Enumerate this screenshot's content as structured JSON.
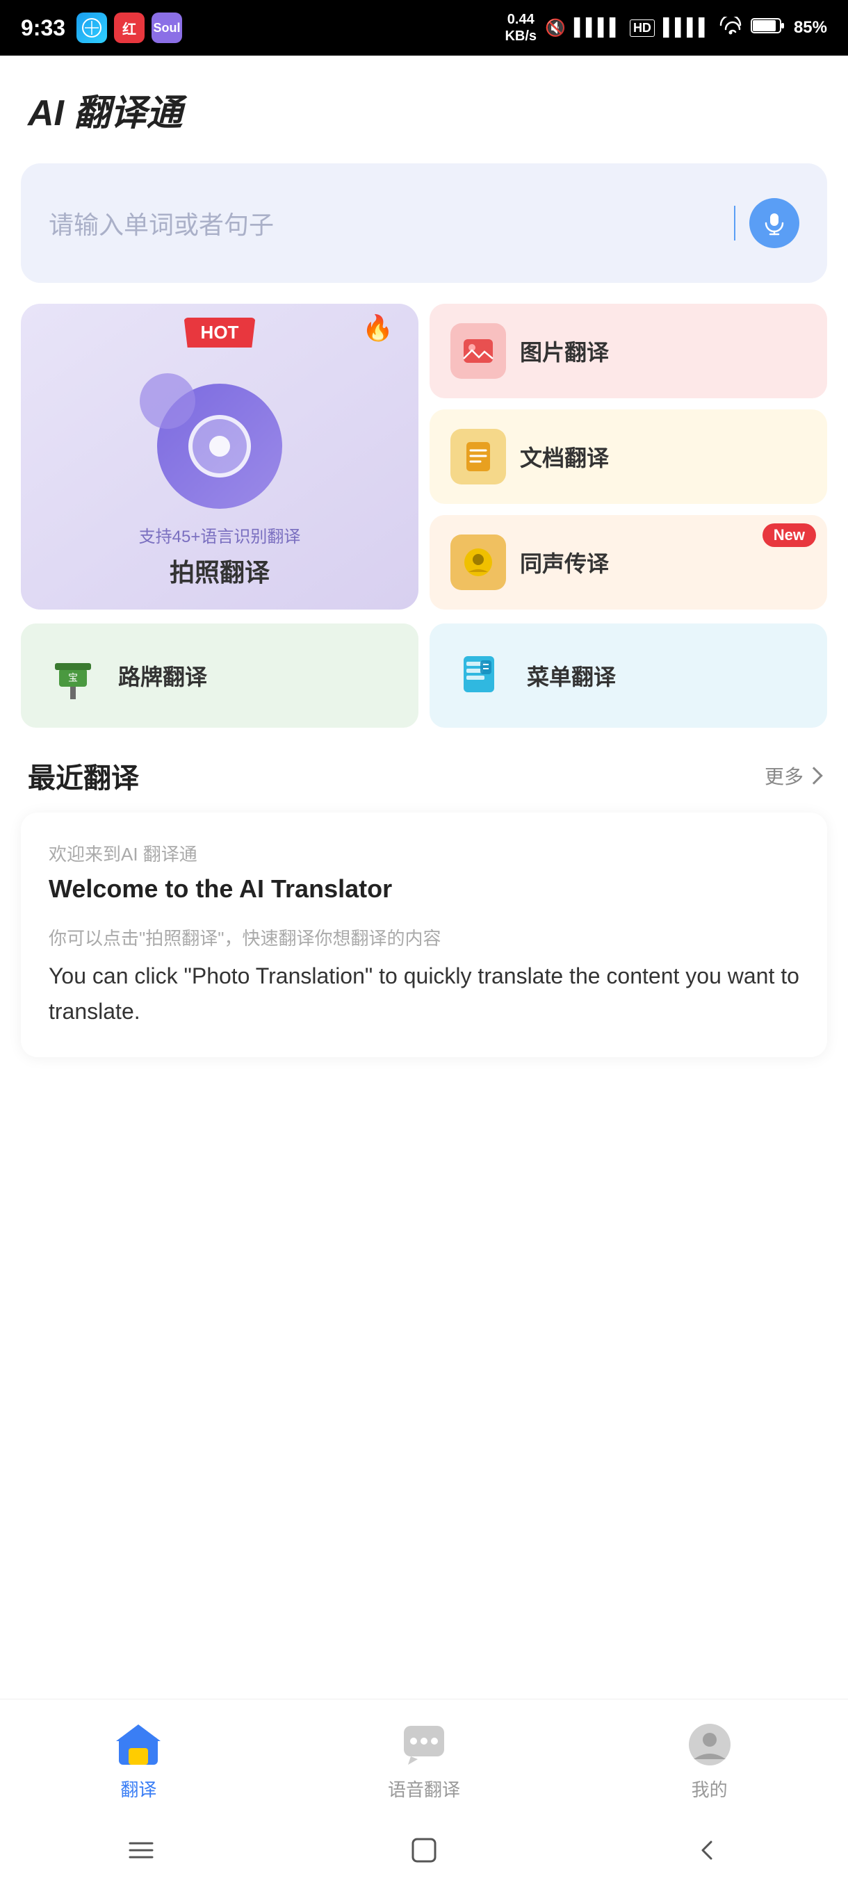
{
  "statusBar": {
    "time": "9:33",
    "network": "0.44\nKB/s",
    "battery": "85%",
    "appIcons": [
      "Safari",
      "红",
      "Soul"
    ]
  },
  "header": {
    "title": "AI 翻译通"
  },
  "searchBar": {
    "placeholder": "请输入单词或者句子"
  },
  "photoTranslation": {
    "hotBadge": "HOT",
    "subText": "支持45+语言识别翻译",
    "label": "拍照翻译"
  },
  "features": [
    {
      "id": "image",
      "label": "图片翻译",
      "badge": null,
      "bgColor": "#fde8e8"
    },
    {
      "id": "document",
      "label": "文档翻译",
      "badge": null,
      "bgColor": "#fff8e6"
    },
    {
      "id": "voice",
      "label": "同声传译",
      "badge": "New",
      "bgColor": "#fff3e8"
    }
  ],
  "bottomCards": [
    {
      "id": "sign",
      "label": "路牌翻译",
      "bgColor": "#eaf5ea"
    },
    {
      "id": "menu",
      "label": "菜单翻译",
      "bgColor": "#e8f6fb"
    }
  ],
  "recentSection": {
    "title": "最近翻译",
    "moreText": "更多"
  },
  "translationCard": {
    "sourceLabel": "欢迎来到AI 翻译通",
    "originalText": "Welcome to the AI Translator",
    "sourceLabel2": "你可以点击\"拍照翻译\"，快速翻译你想翻译的内容",
    "resultText": "You can click \"Photo Translation\" to quickly translate the content you want to translate."
  },
  "bottomNav": {
    "items": [
      {
        "id": "translate",
        "label": "翻译",
        "active": true
      },
      {
        "id": "voice-translate",
        "label": "语音翻译",
        "active": false
      },
      {
        "id": "profile",
        "label": "我的",
        "active": false
      }
    ]
  }
}
